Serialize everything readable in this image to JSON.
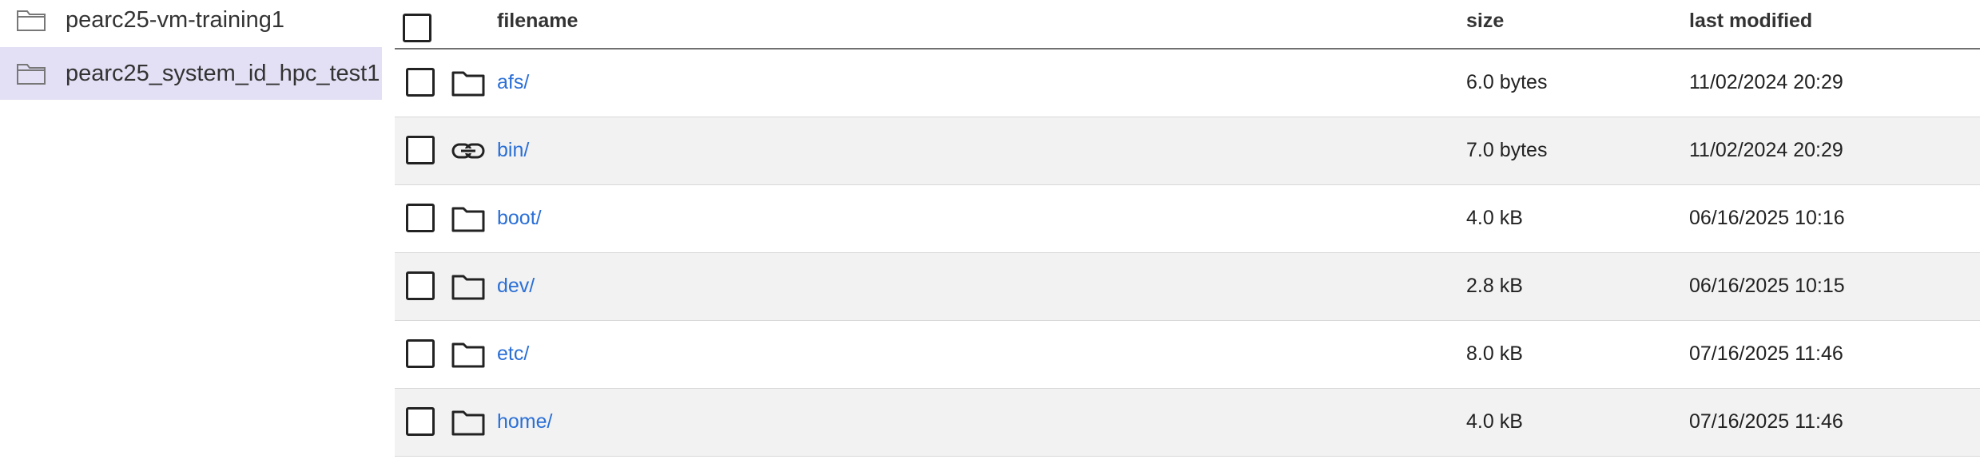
{
  "sidebar": {
    "items": [
      {
        "label": "pearc25-vm-training1",
        "icon": "folder-icon",
        "selected": false
      },
      {
        "label": "pearc25_system_id_hpc_test1",
        "icon": "folder-icon",
        "selected": true
      }
    ]
  },
  "table": {
    "headers": {
      "filename": "filename",
      "size": "size",
      "modified": "last modified"
    },
    "rows": [
      {
        "name": "afs/",
        "icon": "folder-icon",
        "size": "6.0 bytes",
        "modified": "11/02/2024 20:29"
      },
      {
        "name": "bin/",
        "icon": "link-icon",
        "size": "7.0 bytes",
        "modified": "11/02/2024 20:29"
      },
      {
        "name": "boot/",
        "icon": "folder-icon",
        "size": "4.0 kB",
        "modified": "06/16/2025 10:16"
      },
      {
        "name": "dev/",
        "icon": "folder-icon",
        "size": "2.8 kB",
        "modified": "06/16/2025 10:15"
      },
      {
        "name": "etc/",
        "icon": "folder-icon",
        "size": "8.0 kB",
        "modified": "07/16/2025 11:46"
      },
      {
        "name": "home/",
        "icon": "folder-icon",
        "size": "4.0 kB",
        "modified": "07/16/2025 11:46"
      }
    ]
  },
  "colors": {
    "selected_background": "#e3e0f5",
    "link": "#2a6fd6",
    "alt_row": "#f2f2f2"
  }
}
